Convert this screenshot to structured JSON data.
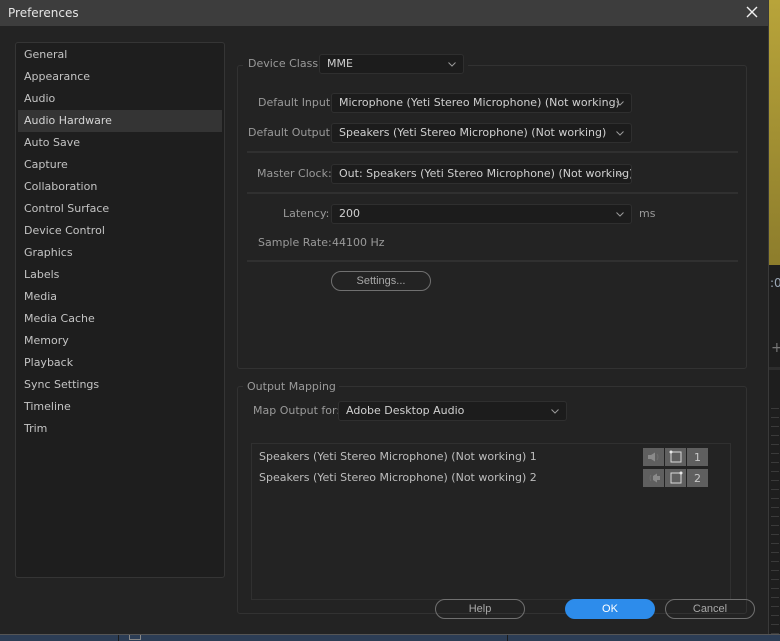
{
  "window": {
    "title": "Preferences",
    "close_icon": "close-icon"
  },
  "sidebar": {
    "selected": "Audio Hardware",
    "items": [
      {
        "label": "General"
      },
      {
        "label": "Appearance"
      },
      {
        "label": "Audio"
      },
      {
        "label": "Audio Hardware"
      },
      {
        "label": "Auto Save"
      },
      {
        "label": "Capture"
      },
      {
        "label": "Collaboration"
      },
      {
        "label": "Control Surface"
      },
      {
        "label": "Device Control"
      },
      {
        "label": "Graphics"
      },
      {
        "label": "Labels"
      },
      {
        "label": "Media"
      },
      {
        "label": "Media Cache"
      },
      {
        "label": "Memory"
      },
      {
        "label": "Playback"
      },
      {
        "label": "Sync Settings"
      },
      {
        "label": "Timeline"
      },
      {
        "label": "Trim"
      }
    ]
  },
  "device": {
    "device_class_label": "Device Class:",
    "device_class_value": "MME",
    "default_input_label": "Default Input:",
    "default_input_value": "Microphone (Yeti Stereo Microphone) (Not working)",
    "default_output_label": "Default Output:",
    "default_output_value": "Speakers (Yeti Stereo Microphone) (Not working)",
    "master_clock_label": "Master Clock:",
    "master_clock_value": "Out: Speakers (Yeti Stereo Microphone) (Not working)",
    "latency_label": "Latency:",
    "latency_value": "200",
    "latency_unit": "ms",
    "sample_rate_label": "Sample Rate:",
    "sample_rate_value": "44100 Hz",
    "settings_button": "Settings..."
  },
  "output_mapping": {
    "group_title": "Output Mapping",
    "map_output_label": "Map Output for:",
    "map_output_value": "Adobe Desktop Audio",
    "channels": [
      {
        "name": "Speakers (Yeti Stereo Microphone) (Not working) 1",
        "speaker_icon": "speaker-left-icon",
        "box_icon": "channel-box-icon",
        "number": "1"
      },
      {
        "name": "Speakers (Yeti Stereo Microphone) (Not working) 2",
        "speaker_icon": "speaker-right-icon",
        "box_icon": "channel-box-icon",
        "number": "2"
      }
    ]
  },
  "footer": {
    "help": "Help",
    "ok": "OK",
    "cancel": "Cancel"
  },
  "colors": {
    "accent": "#2d8ceb",
    "titlebar": "#3d3d3d",
    "background": "#232323"
  }
}
